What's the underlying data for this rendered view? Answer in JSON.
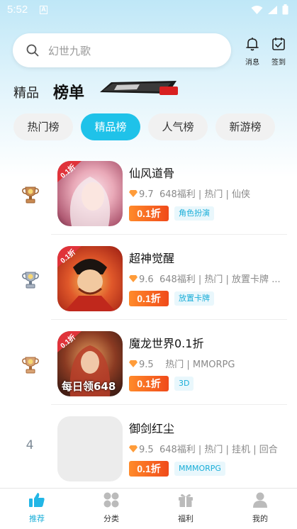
{
  "status_bar": {
    "time": "5:52",
    "notif": "A"
  },
  "search": {
    "placeholder": "幻世九歌"
  },
  "header": {
    "messages_label": "消息",
    "checkin_label": "签到"
  },
  "top_tabs": {
    "featured": "精品",
    "ranking": "榜单"
  },
  "chips": [
    "热门榜",
    "精品榜",
    "人气榜",
    "新游榜"
  ],
  "active_chip": "精品榜",
  "games": [
    {
      "rank": "1",
      "name": "仙风道骨",
      "score": "9.7",
      "meta": "648福利 | 热门 | 仙侠",
      "discount": "0.1折",
      "tag": "角色扮演",
      "icon_badge": "0.1折"
    },
    {
      "rank": "2",
      "name": "超神觉醒",
      "score": "9.6",
      "meta": "648福利 | 热门 | 放置卡牌 ...",
      "discount": "0.1折",
      "tag": "放置卡牌",
      "icon_badge": "0.1折"
    },
    {
      "rank": "3",
      "name": "魔龙世界0.1折",
      "score": "9.5",
      "meta": "热门 | MMORPG",
      "discount": "0.1折",
      "tag": "3D",
      "icon_badge": "0.1折",
      "icon_caption": "每日领648"
    },
    {
      "rank": "4",
      "name": "御剑红尘",
      "score": "9.5",
      "meta": "648福利 | 热门 | 挂机 | 回合",
      "discount": "0.1折",
      "tag": "MMMORPG"
    }
  ],
  "bottom_nav": [
    {
      "label": "推荐",
      "icon": "thumbs-up-icon",
      "active": true
    },
    {
      "label": "分类",
      "icon": "grid-icon",
      "active": false
    },
    {
      "label": "福利",
      "icon": "gift-icon",
      "active": false
    },
    {
      "label": "我的",
      "icon": "user-icon",
      "active": false
    }
  ],
  "colors": {
    "accent": "#1fc2e9",
    "discount": "#f04a1a",
    "tag_text": "#1aaed8"
  }
}
